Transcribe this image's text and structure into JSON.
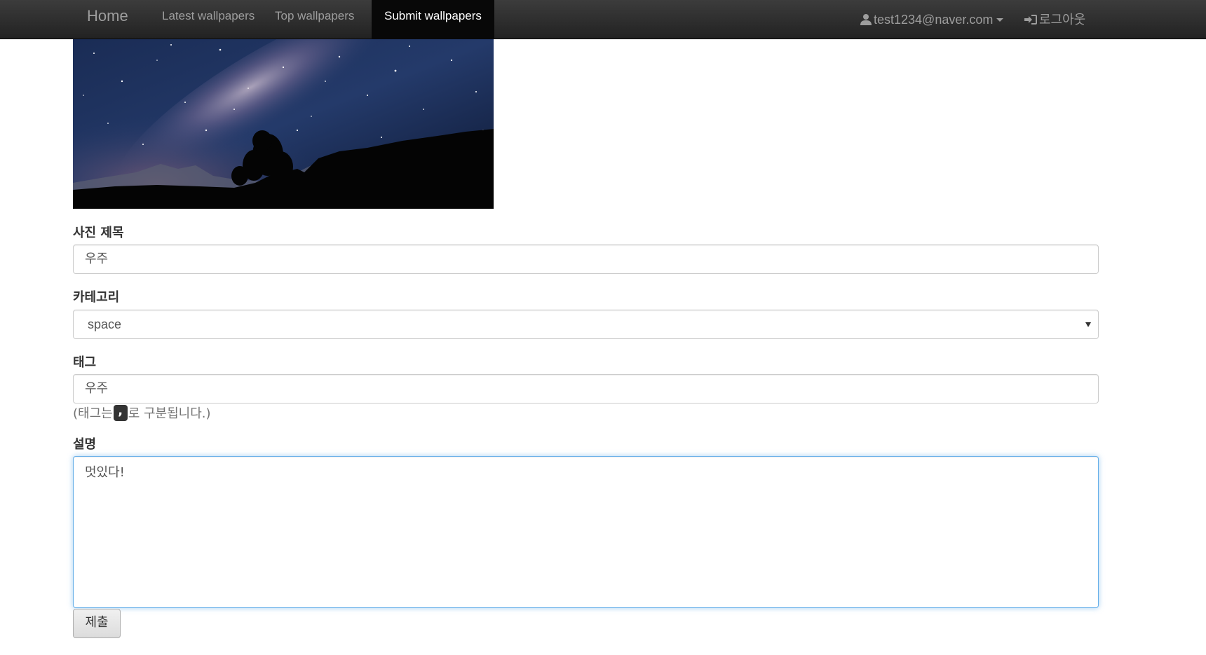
{
  "navbar": {
    "brand": "Home",
    "links": [
      {
        "label": "Latest wallpapers",
        "active": false
      },
      {
        "label": "Top wallpapers",
        "active": false
      },
      {
        "label": "Submit wallpapers",
        "active": true
      }
    ],
    "user_email": "test1234@naver.com",
    "logout_label": "로그아웃",
    "icons": [
      "user-icon",
      "chevron-down-icon",
      "log-in-icon"
    ]
  },
  "hero": {
    "image": "starry-night-sky-icon"
  },
  "form": {
    "title_label": "사진 제목",
    "title_value": "우주",
    "category_label": "카테고리",
    "category_value": "space",
    "tag_label": "태그",
    "tag_value": "우주",
    "tag_help_prefix": "(태그는 ",
    "tag_help_separator": ",",
    "tag_help_suffix": "로 구분됩니다.)",
    "description_label": "설명",
    "description_value": "멋있다!",
    "submit_label": "제출"
  },
  "colors": {
    "navbar_bg": "#222222",
    "nav_text": "#9d9d9d",
    "nav_active_bg": "#080808",
    "focus_border": "#66afe9"
  }
}
